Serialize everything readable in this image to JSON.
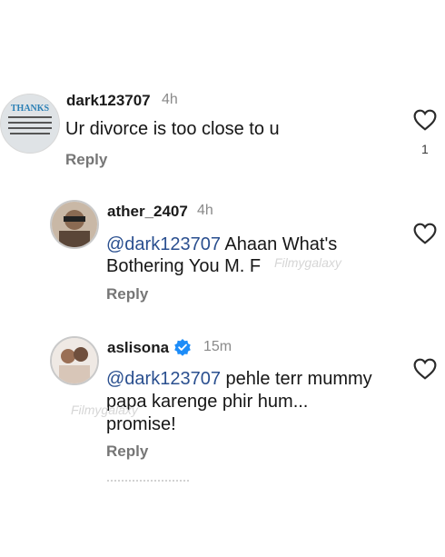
{
  "comments": [
    {
      "username": "dark123707",
      "time": "4h",
      "text": "Ur divorce is too close to u",
      "reply_label": "Reply",
      "like_count": "1",
      "avatar_text": "THANKS"
    },
    {
      "username": "ather_2407",
      "time": "4h",
      "mention": "@dark123707",
      "text_line1": " Ahaan What's",
      "text_line2": "Bothering You M. F",
      "reply_label": "Reply"
    },
    {
      "username": "aslisona",
      "time": "15m",
      "mention": "@dark123707",
      "text_line1": " pehle terr mummy",
      "text_line2": "papa karenge phir hum...",
      "text_line3": "promise!",
      "reply_label": "Reply"
    }
  ],
  "watermark": "Filmygalaxy",
  "colors": {
    "mention": "#2a4f8f",
    "verified": "#1d8cf8"
  }
}
